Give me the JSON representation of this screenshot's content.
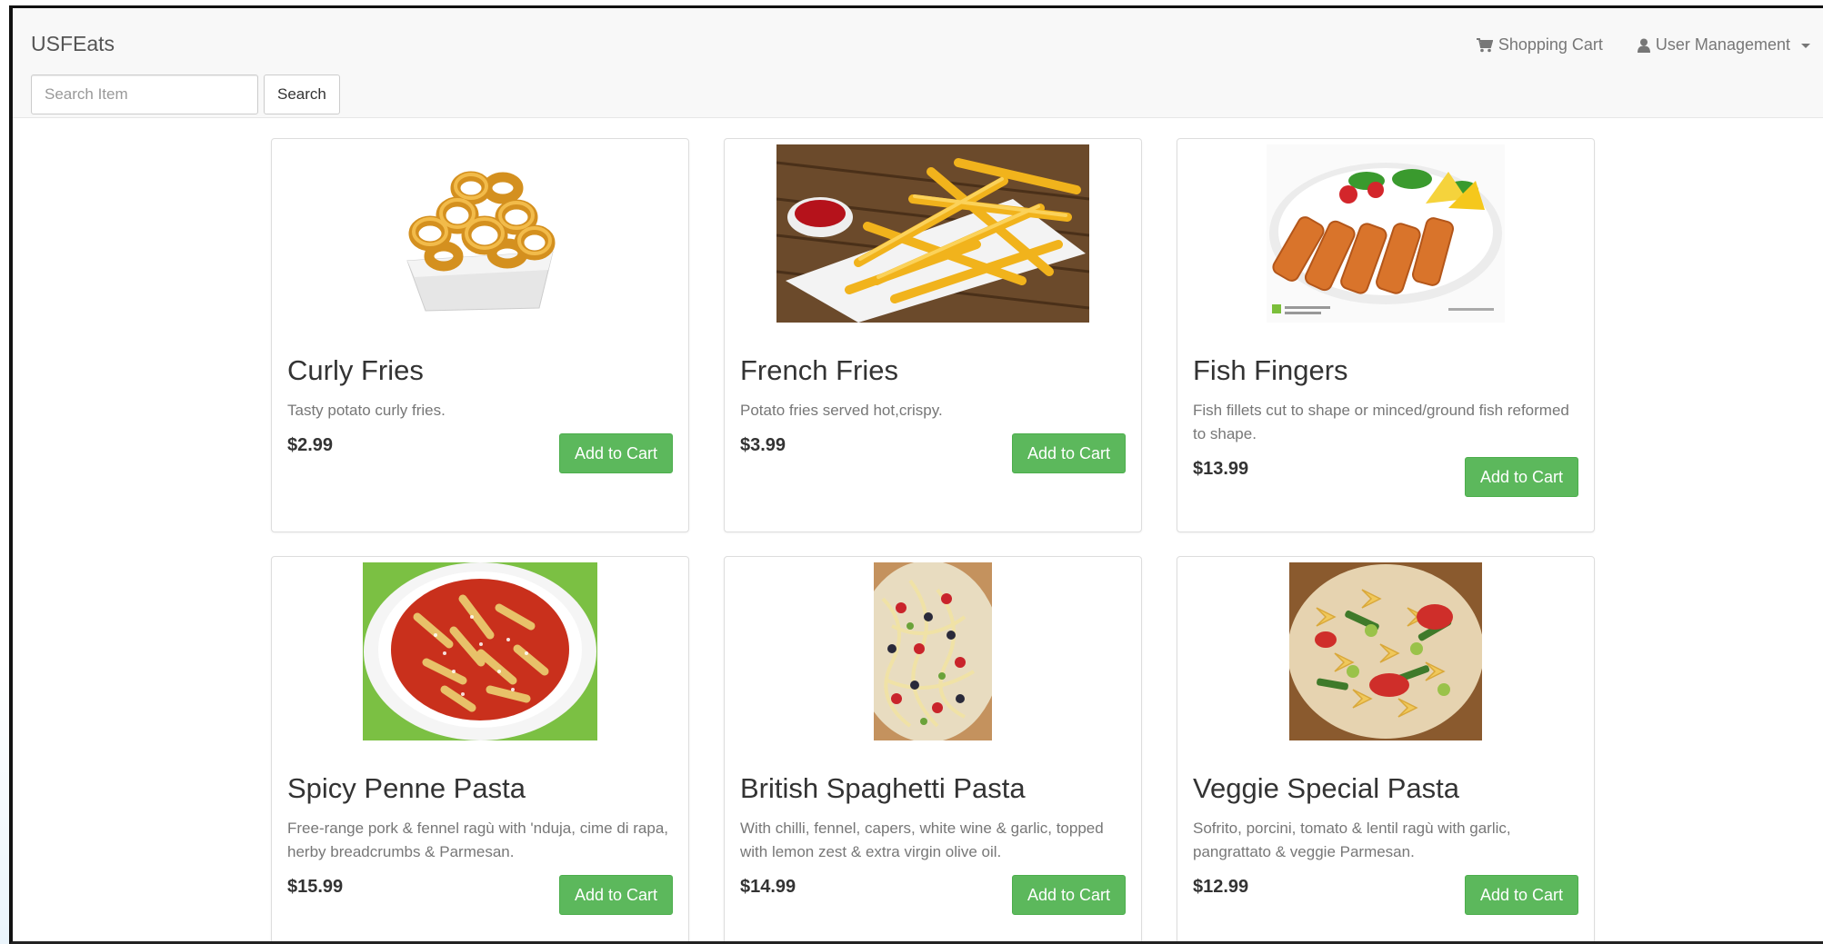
{
  "app": {
    "brand": "USFEats"
  },
  "nav": {
    "cart_label": "Shopping Cart",
    "user_label": "User Management"
  },
  "search": {
    "placeholder": "Search Item",
    "value": "",
    "button_label": "Search"
  },
  "products": [
    {
      "name": "Curly Fries",
      "description": "Tasty potato curly fries.",
      "price": "$2.99",
      "button_label": "Add to Cart",
      "image": "curly-fries"
    },
    {
      "name": "French Fries",
      "description": "Potato fries served hot,crispy.",
      "price": "$3.99",
      "button_label": "Add to Cart",
      "image": "french-fries"
    },
    {
      "name": "Fish Fingers",
      "description": "Fish fillets cut to shape or minced/ground fish reformed to shape.",
      "price": "$13.99",
      "button_label": "Add to Cart",
      "image": "fish-fingers"
    },
    {
      "name": "Spicy Penne Pasta",
      "description": "Free-range pork & fennel ragù with 'nduja, cime di rapa, herby breadcrumbs & Parmesan.",
      "price": "$15.99",
      "button_label": "Add to Cart",
      "image": "penne-pasta"
    },
    {
      "name": "British Spaghetti Pasta",
      "description": "With chilli, fennel, capers, white wine & garlic, topped with lemon zest & extra virgin olive oil.",
      "price": "$14.99",
      "button_label": "Add to Cart",
      "image": "spaghetti-salad"
    },
    {
      "name": "Veggie Special Pasta",
      "description": "Sofrito, porcini, tomato & lentil ragù with garlic, pangrattato & veggie Parmesan.",
      "price": "$12.99",
      "button_label": "Add to Cart",
      "image": "veggie-pasta"
    }
  ],
  "colors": {
    "navbar_bg": "#f8f8f8",
    "success_green": "#5cb85c",
    "text_dark": "#333333",
    "text_muted": "#777777"
  }
}
